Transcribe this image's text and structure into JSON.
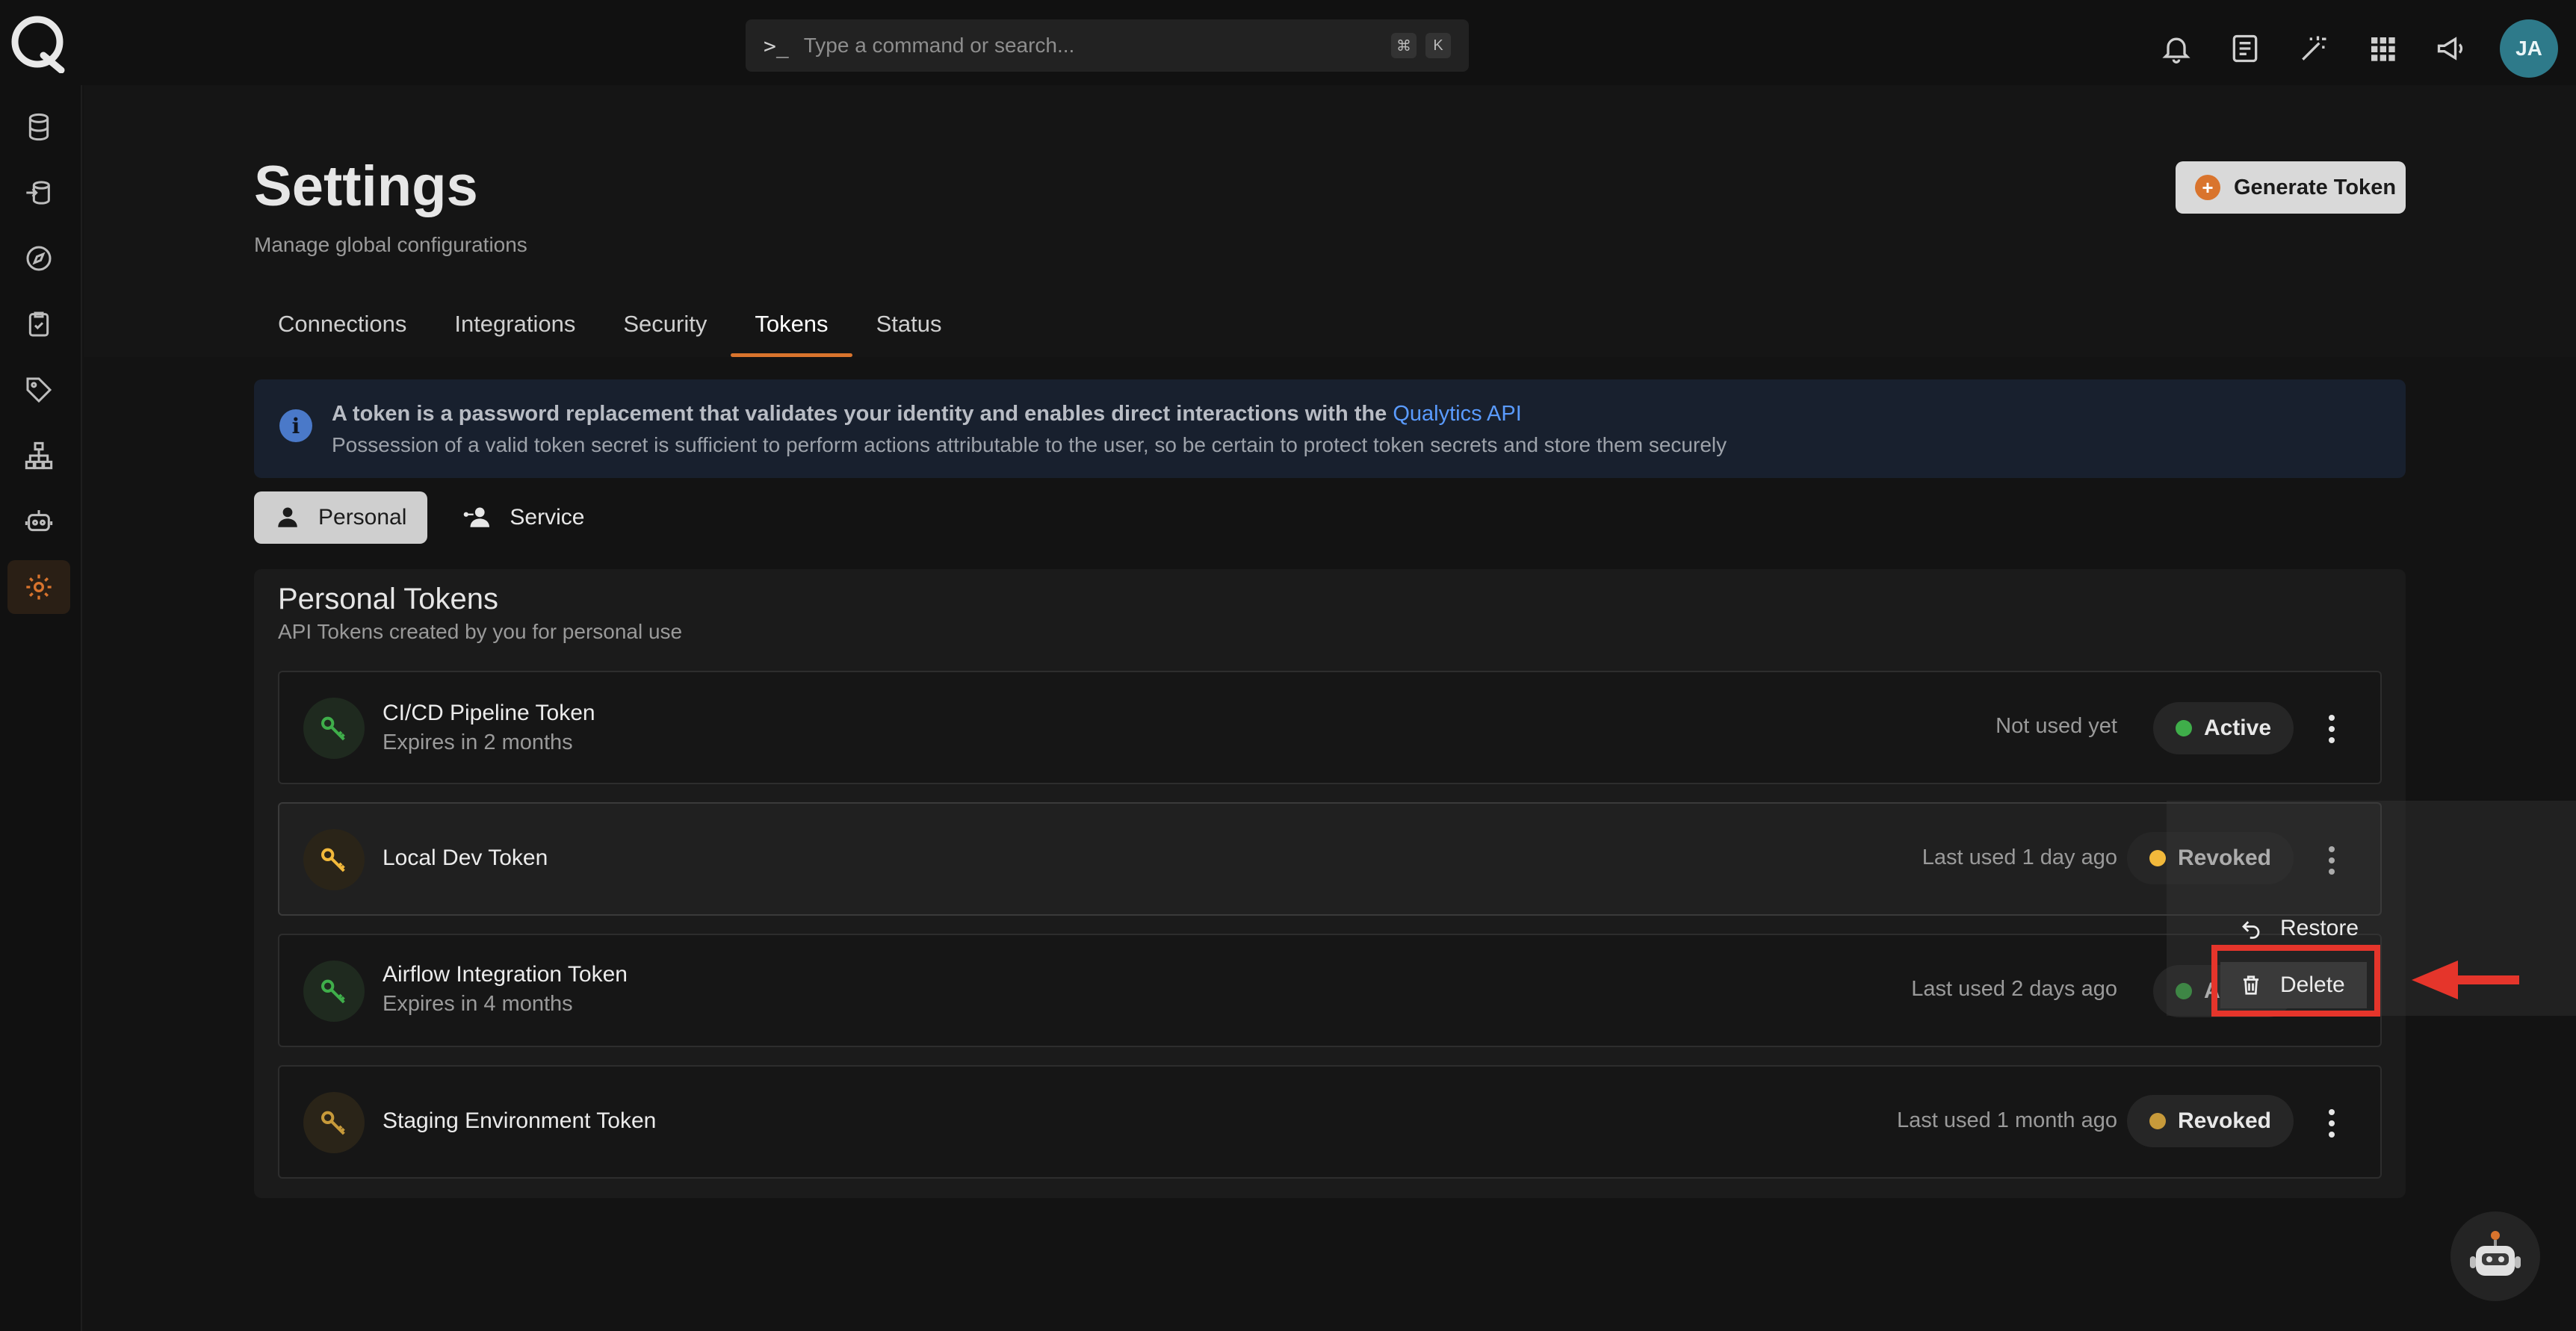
{
  "search": {
    "prompt_glyph": ">_",
    "placeholder": "Type a command or search...",
    "shortcut": [
      "⌘",
      "K"
    ]
  },
  "user": {
    "initials": "JA",
    "avatar_color": "#2e7a8a"
  },
  "accent_color": "#d9742d",
  "top_icons": [
    "bell-icon",
    "notes-icon",
    "magic-wand-icon",
    "apps-grid-icon",
    "megaphone-icon"
  ],
  "sidebar": {
    "items": [
      {
        "icon": "database-icon"
      },
      {
        "icon": "datastores-icon"
      },
      {
        "icon": "compass-icon"
      },
      {
        "icon": "checklist-icon"
      },
      {
        "icon": "tag-icon"
      },
      {
        "icon": "hierarchy-icon"
      },
      {
        "icon": "robot-icon"
      },
      {
        "icon": "settings-gear-icon",
        "active": true
      }
    ]
  },
  "page": {
    "title": "Settings",
    "subtitle": "Manage global configurations",
    "generate_button": "Generate Token",
    "tabs": [
      "Connections",
      "Integrations",
      "Security",
      "Tokens",
      "Status"
    ],
    "active_tab": "Tokens"
  },
  "info": {
    "line1": "A token is a password replacement that validates your identity and enables direct interactions with the",
    "link": "Qualytics API",
    "line2": "Possession of a valid token secret is sufficient to perform actions attributable to the user, so be certain to protect token secrets and store them securely"
  },
  "segments": {
    "personal": "Personal",
    "service": "Service",
    "active": "Personal"
  },
  "tokens_card": {
    "title": "Personal Tokens",
    "subtitle": "API Tokens created by you for personal use",
    "rows": [
      {
        "name": "CI/CD Pipeline Token",
        "expires": "Expires in 2 months",
        "last_used": "Not used yet",
        "status": "Active",
        "status_color": "#3fae4a"
      },
      {
        "name": "Local Dev Token",
        "expires": "",
        "last_used": "Last used 1 day ago",
        "status": "Revoked",
        "status_color": "#f2b93b"
      },
      {
        "name": "Airflow Integration Token",
        "expires": "Expires in 4 months",
        "last_used": "Last used 2 days ago",
        "status": "Active",
        "status_color": "#3fae4a"
      },
      {
        "name": "Staging Environment Token",
        "expires": "",
        "last_used": "Last used 1 month ago",
        "status": "Revoked",
        "status_color": "#c79a3a"
      }
    ]
  },
  "context_menu": {
    "restore": "Restore",
    "delete": "Delete"
  }
}
